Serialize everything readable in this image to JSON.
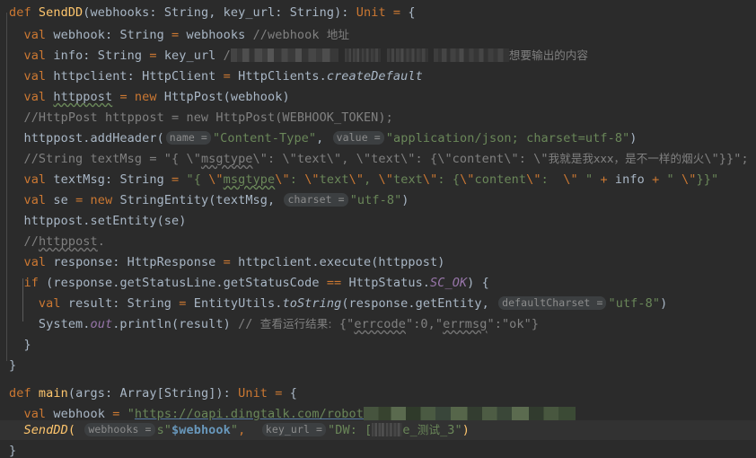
{
  "editor": {
    "language": "Scala",
    "theme": "Darcula",
    "background": "#2b2b2b",
    "default_text_color": "#a9b7c6",
    "colors": {
      "keyword": "#cc7832",
      "string": "#6a8759",
      "comment": "#808080",
      "number": "#6897bb",
      "static_field": "#9876aa",
      "function": "#ffc66d",
      "identifier": "#a9b7c6",
      "inlay_hint_bg": "#3c3f41",
      "inlay_hint_fg": "#8c8c8c",
      "selection_line_bg": "#323232",
      "indent_guide": "#4b4b4b"
    }
  },
  "code": {
    "lines": [
      {
        "n": 1,
        "indent": 0,
        "text": "def SendDD(webhooks: String, key_url: String): Unit = {"
      },
      {
        "n": 2,
        "indent": 1,
        "text": "val webhook: String = webhooks //webhook 地址",
        "comment": "//webhook 地址"
      },
      {
        "n": 3,
        "indent": 1,
        "text": "val info: String = key_url //[redacted] 想要输出的内容",
        "comment_tail": "想要输出的内容"
      },
      {
        "n": 4,
        "indent": 1,
        "text": "val httpclient: HttpClient = HttpClients.createDefault"
      },
      {
        "n": 5,
        "indent": 1,
        "text": "val httppost = new HttpPost(webhook)"
      },
      {
        "n": 6,
        "indent": 1,
        "text": "//HttpPost httppost = new HttpPost(WEBHOOK_TOKEN);"
      },
      {
        "n": 7,
        "indent": 1,
        "text": "httppost.addHeader(name = \"Content-Type\", value = \"application/json; charset=utf-8\")",
        "hints": [
          "name =",
          "value ="
        ]
      },
      {
        "n": 8,
        "indent": 1,
        "text": "//String textMsg = \"{ \\\"msgtype\\\": \\\"text\\\", \\\"text\\\": {\\\"content\\\": \\\"我就是我xxx，是不一样的烟火\\\"}}\";"
      },
      {
        "n": 9,
        "indent": 1,
        "text": "val textMsg: String = \"{ \\\"msgtype\\\": \\\"text\\\", \\\"text\\\": {\\\"content\\\":  \\\" \" + info + \" \\\"}}\""
      },
      {
        "n": 10,
        "indent": 1,
        "text": "val se = new StringEntity(textMsg, charset = \"utf-8\")",
        "hints": [
          "charset ="
        ]
      },
      {
        "n": 11,
        "indent": 1,
        "text": "httppost.setEntity(se)"
      },
      {
        "n": 12,
        "indent": 1,
        "text": "//httppost."
      },
      {
        "n": 13,
        "indent": 1,
        "text": "val response: HttpResponse = httpclient.execute(httppost)"
      },
      {
        "n": 14,
        "indent": 1,
        "text": "if (response.getStatusLine.getStatusCode == HttpStatus.SC_OK) {"
      },
      {
        "n": 15,
        "indent": 2,
        "text": "val result: String = EntityUtils.toString(response.getEntity, defaultCharset = \"utf-8\")",
        "hints": [
          "defaultCharset ="
        ]
      },
      {
        "n": 16,
        "indent": 2,
        "text": "System.out.println(result) // 查看运行结果: {\"errcode\":0,\"errmsg\":\"ok\"}",
        "comment": "// 查看运行结果: {\"errcode\":0,\"errmsg\":\"ok\"}"
      },
      {
        "n": 17,
        "indent": 1,
        "text": "}"
      },
      {
        "n": 18,
        "indent": 0,
        "text": "}"
      },
      {
        "n": 19,
        "indent": 0,
        "text": ""
      },
      {
        "n": 20,
        "indent": 0,
        "text": "def main(args: Array[String]): Unit = {"
      },
      {
        "n": 21,
        "indent": 1,
        "text": "val webhook = \"https://oapi.dingtalk.com/robot[redacted]\"",
        "link": "https://oapi.dingtalk.com/robot"
      },
      {
        "n": 22,
        "indent": 1,
        "text": "SendDD(webhooks = s\"$webhook\", key_url = \"DW: [redacted]e_测试_3\")",
        "hints": [
          "webhooks =",
          "key_url ="
        ],
        "selected": true
      },
      {
        "n": 23,
        "indent": 0,
        "text": "}"
      }
    ],
    "tokens": {
      "kw_def": "def",
      "kw_val": "val",
      "kw_new": "new",
      "kw_if": "if",
      "fn_sendd": "SendDD",
      "fn_main": "main",
      "type_string": "String",
      "type_unit": "Unit",
      "type_httpclient": "HttpClient",
      "type_httpresponse": "HttpResponse",
      "static_sc_ok": "SC_OK",
      "static_out": "out",
      "method_createdefault": "createDefault",
      "method_tostring": "toString"
    },
    "strings": {
      "content_type": "\"Content-Type\"",
      "application_json": "\"application/json; charset=utf-8\"",
      "utf8": "\"utf-8\"",
      "webhook_interp": "s\"$webhook\"",
      "key_url_prefix": "\"DW: ",
      "key_url_suffix": "e_测试_3\""
    },
    "comments": {
      "webhook_addr": "//webhook 地址",
      "info_tail": "想要输出的内容",
      "httppost_token": "//HttpPost httppost = new HttpPost(WEBHOOK_TOKEN);",
      "string_textmsg": "//String textMsg = \"{ \\\"msgtype\\\": \\\"text\\\", \\\"text\\\": {\\\"content\\\": \\\"我就是我xxx，是不一样的烟火\\\"}}\";",
      "httppost_dot": "//httppost.",
      "result_check": "// 查看运行结果: {\"errcode\":0,\"errmsg\":\"ok\"}",
      "result_check_cjk": "查看运行结果:",
      "result_check_json": "{\"errcode\":0,\"errmsg\":\"ok\"}",
      "cjk_msg": "我就是我xxx，是不一样的烟火"
    },
    "inlay_hints": {
      "name": "name =",
      "value": "value =",
      "charset": "charset =",
      "default_charset": "defaultCharset =",
      "webhooks": "webhooks =",
      "key_url": "key_url ="
    }
  }
}
